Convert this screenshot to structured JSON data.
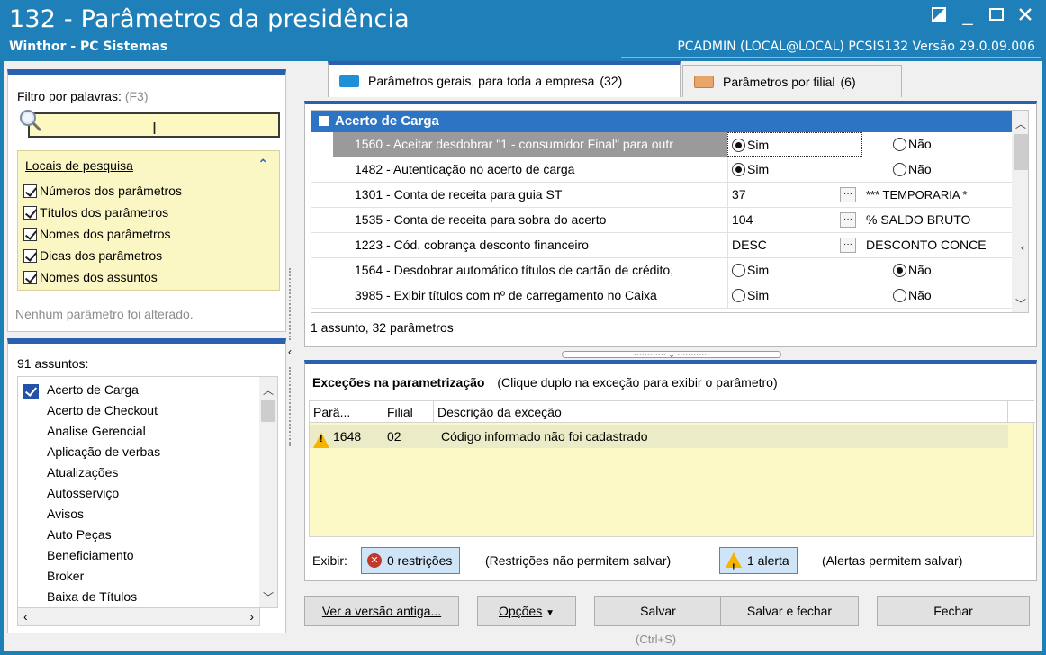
{
  "window": {
    "title": "132 - Parâmetros da presidência",
    "subtitle": "Winthor - PC Sistemas",
    "session": "PCADMIN (LOCAL@LOCAL)  PCSIS132  Versão  29.0.09.006"
  },
  "filter": {
    "label": "Filtro por palavras:",
    "shortcut": "(F3)",
    "value": ""
  },
  "locais": {
    "header": "Locais de pesquisa",
    "options": [
      {
        "label": "Números dos parâmetros",
        "checked": true
      },
      {
        "label": "Títulos dos parâmetros",
        "checked": true
      },
      {
        "label": "Nomes dos parâmetros",
        "checked": true
      },
      {
        "label": "Dicas dos parâmetros",
        "checked": true
      },
      {
        "label": "Nomes dos assuntos",
        "checked": true
      }
    ]
  },
  "status_left": "Nenhum parâmetro foi alterado.",
  "subjects": {
    "count_label": "91 assuntos:",
    "items": [
      "Acerto de Carga",
      "Acerto de Checkout",
      "Analise Gerencial",
      "Aplicação de verbas",
      "Atualizações",
      "Autosserviço",
      "Avisos",
      "Auto Peças",
      "Beneficiamento",
      "Broker",
      "Baixa de Títulos"
    ],
    "selected": "Acerto de Carga"
  },
  "tabs": [
    {
      "label": "Parâmetros gerais, para toda a empresa",
      "count": "(32)",
      "active": true
    },
    {
      "label": "Parâmetros por filial",
      "count": "(6)",
      "active": false
    }
  ],
  "grid": {
    "group": "Acerto de Carga",
    "rows": [
      {
        "name": "1560 - Aceitar desdobrar \"1 - consumidor Final\" para outr",
        "type": "radio",
        "opt1": "Sim",
        "opt2": "Não",
        "selected": "Sim"
      },
      {
        "name": "1482 - Autenticação no acerto de carga",
        "type": "radio",
        "opt1": "Sim",
        "opt2": "Não",
        "selected": "Sim"
      },
      {
        "name": "1301 - Conta de receita para guia ST",
        "type": "lookup",
        "value": "37",
        "desc": "*** TEMPORARIA *"
      },
      {
        "name": "1535 - Conta de receita para sobra do acerto",
        "type": "lookup",
        "value": "104",
        "desc": "% SALDO BRUTO"
      },
      {
        "name": "1223 - Cód. cobrança desconto financeiro",
        "type": "lookup",
        "value": "DESC",
        "desc": "DESCONTO CONCE"
      },
      {
        "name": "1564 - Desdobrar automático títulos de cartão de crédito,",
        "type": "radio",
        "opt1": "Sim",
        "opt2": "Não",
        "selected": "Não"
      },
      {
        "name": "3985 - Exibir títulos com nº de carregamento no Caixa",
        "type": "radio",
        "opt1": "Sim",
        "opt2": "Não",
        "selected": "Não"
      }
    ],
    "footer": "1 assunto, 32 parâmetros"
  },
  "exceptions": {
    "title": "Exceções na parametrização",
    "hint": "(Clique duplo na exceção para exibir o parâmetro)",
    "columns": [
      "Parâ...",
      "Filial",
      "Descrição da exceção"
    ],
    "rows": [
      {
        "param": "1648",
        "filial": "02",
        "desc": "Código informado não foi cadastrado"
      }
    ],
    "exibir_label": "Exibir:",
    "restricoes_btn": "0 restrições",
    "restricoes_note": "(Restrições não permitem salvar)",
    "alerta_btn": "1 alerta",
    "alerta_note": "(Alertas permitem salvar)"
  },
  "buttons": {
    "old_version": "Ver a versão antiga...",
    "options": "Opções",
    "save": "Salvar",
    "save_shortcut": "(Ctrl+S)",
    "save_close": "Salvar e fechar",
    "close": "Fechar"
  },
  "colors": {
    "titlebar": "#1f7fb8",
    "accent_blue": "#2b5fb0",
    "group_row": "#2e74c4",
    "yellow_bg": "#fdf7c2",
    "warning": "#f4b400"
  }
}
